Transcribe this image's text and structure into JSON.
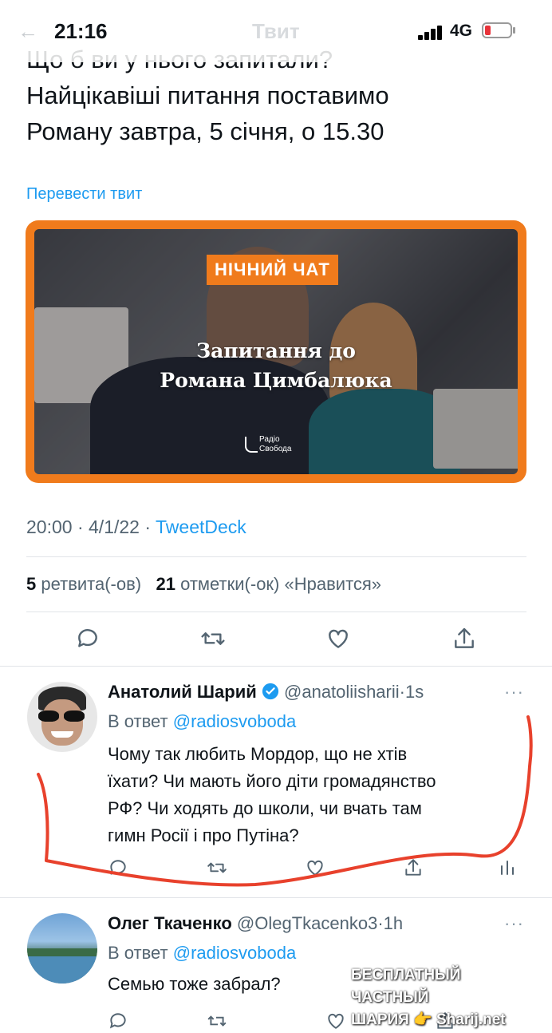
{
  "status_bar": {
    "time": "21:16",
    "network": "4G"
  },
  "header": {
    "back": "←",
    "title": "Твит"
  },
  "tweet": {
    "text_lines": [
      "Що б ви у нього запитали?",
      "Найцікавіші питання поставимо",
      "Роману завтра, 5 січня, о 15.30"
    ],
    "translate_label": "Перевести твит",
    "media": {
      "badge": "НІЧНИЙ ЧАТ",
      "headline_line1": "Запитання до",
      "headline_line2": "Романа Цимбалюка",
      "logo_line1": "Радіо",
      "logo_line2": "Свобода"
    },
    "time": "20:00",
    "date": "4/1/22",
    "source": "TweetDeck",
    "separator": "·",
    "retweets_count": "5",
    "retweets_label": "ретвита(-ов)",
    "likes_count": "21",
    "likes_label": "отметки(-ок) «Нравится»"
  },
  "replies": [
    {
      "name": "Анатолий Шарий",
      "verified": true,
      "handle": "@anatoliisharii",
      "time": "1s",
      "reply_prefix": "В ответ",
      "reply_to": "@radiosvoboda",
      "text_lines": [
        "Чому так любить Мордор, що не хтів",
        "їхати? Чи мають його діти громадянство",
        "РФ? Чи ходять до школи, чи вчать там",
        "гимн Росії і про Путіна?"
      ]
    },
    {
      "name": "Олег Ткаченко",
      "verified": false,
      "handle": "@OlegTkacenko3",
      "time": "1h",
      "reply_prefix": "В ответ",
      "reply_to": "@radiosvoboda",
      "text_lines": [
        "Семью тоже забрал?"
      ]
    }
  ],
  "more_label": "···",
  "watermark": {
    "line1": "БЕСПЛАТНЫЙ ЧАСТНЫЙ",
    "line2": "ШАРИЯ 👉 Sharij.net"
  },
  "colors": {
    "link": "#1d9bf0",
    "media_frame": "#f07b1c",
    "annotation": "#e8412c",
    "battery_low": "#e8333a"
  }
}
